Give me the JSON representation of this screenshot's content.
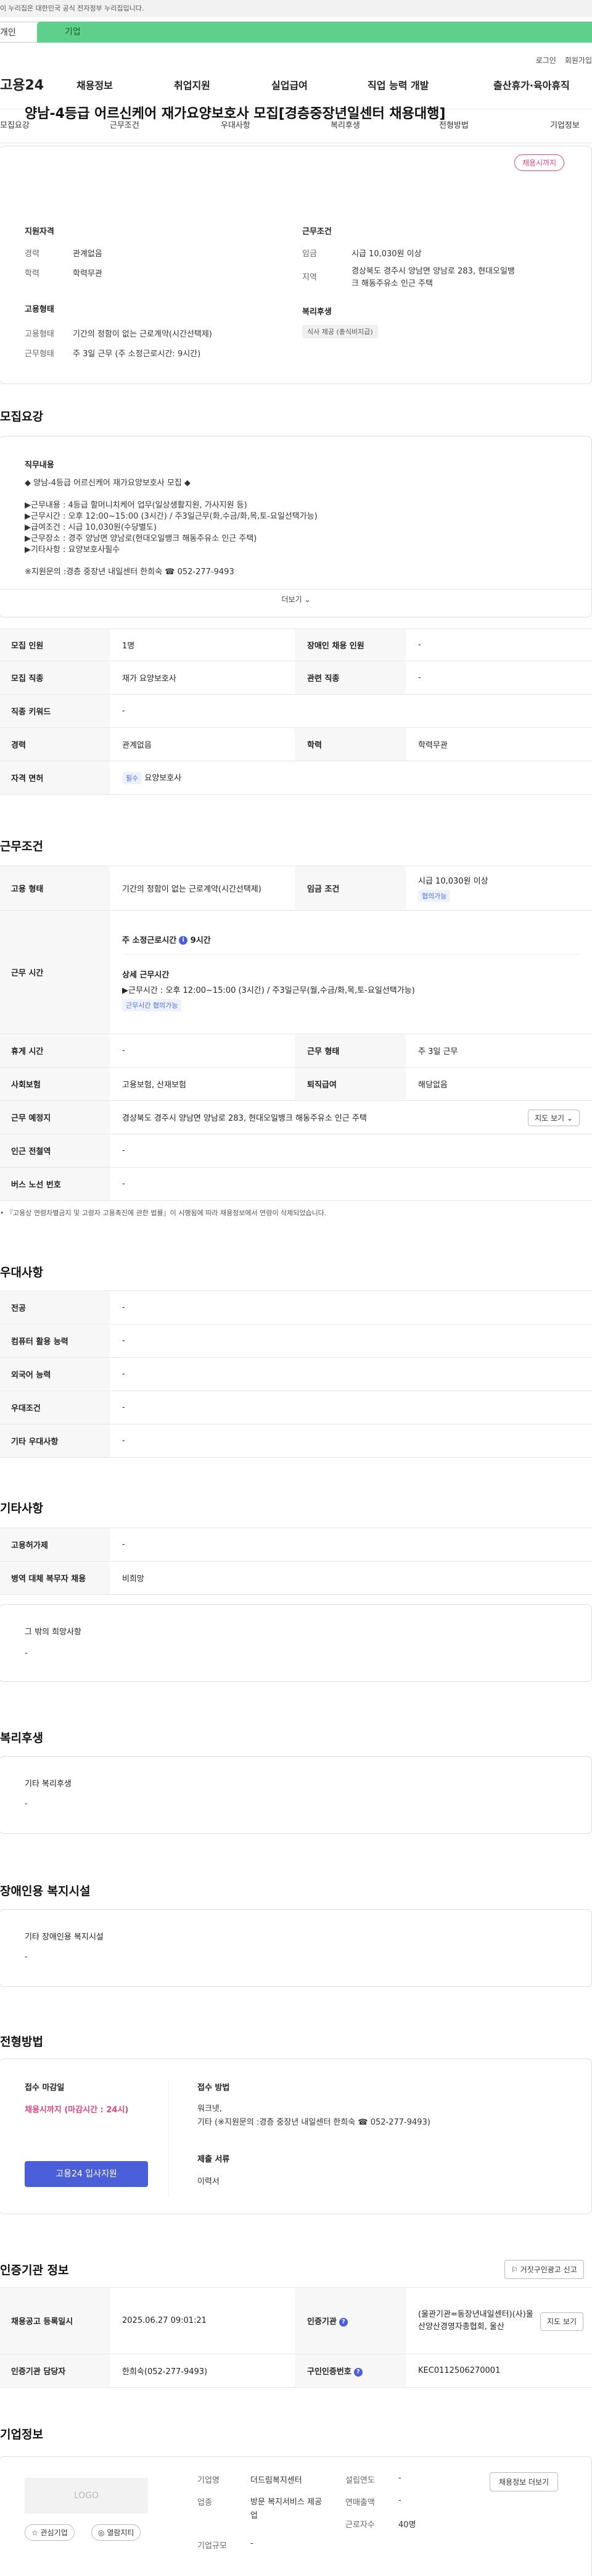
{
  "gov_banner": "이 누리집은 대한민국 공식 전자정부 누리집입니다.",
  "top_tabs": {
    "person": "개인",
    "corp": "기업"
  },
  "util": [
    "로그인",
    "회원가입"
  ],
  "brand": "고용24",
  "gnb": [
    "채용정보",
    "취업지원",
    "실업급여",
    "직업 능력 개발",
    "출산휴가·육아휴직"
  ],
  "subnav": [
    "모집요강",
    "근무조건",
    "우대사항",
    "복리후생",
    "전형방법",
    "기업정보"
  ],
  "header": {
    "title": "양남-4등급 어르신케어 재가요양보호사 모집[경층중장년일센터 채용대행]",
    "badge": "채용시까지",
    "qual_head": "지원자격",
    "qual": [
      {
        "k": "경력",
        "v": "관계없음"
      },
      {
        "k": "학력",
        "v": "학력무관"
      }
    ],
    "cond_head": "근무조건",
    "cond": [
      {
        "k": "임금",
        "v": "시급 10,030원 이상"
      },
      {
        "k": "지역",
        "v": "경상북도 경주시 양남면 양남로 283, 현대오일뱅크 해동주유소 인근 주택"
      }
    ],
    "emp_head": "고용형태",
    "emp": [
      {
        "k": "고용형태",
        "v": "기간의 정함이 없는 근로계약(시간선택제)"
      },
      {
        "k": "근무형태",
        "v": "주 3일 근무 (주 소정근로시간: 9시간)"
      }
    ],
    "welfare_head": "복리후생",
    "welfare_chip": "식사 제공 (총식비지급)"
  },
  "recruit": {
    "section": "모집요강",
    "duty_head": "직무내용",
    "duty_lines": [
      "◆ 양남-4등급 어르신케어 재가요양보호사 모집 ◆",
      "",
      "▶근무내용 : 4등급 할머니치케어 업무(일상생활지원, 가사지원 등)",
      "▶근무시간 : 오후 12:00~15:00 (3시간) / 주3일근무(화,수금/화,목,토-요일선택가능)",
      "▶급여조건 : 시급 10,030원(수당별도)",
      "▶근무장소 : 경주 양남면 양남로(현대오일뱅크 해동주유소 인근 주택)",
      "▶기타사항 : 요양보호사필수",
      "",
      "※지원문의 :경층 중장년 내일센터  한희숙 ☎ 052-277-9493"
    ],
    "more": "더보기",
    "rows": [
      {
        "k": "모집 인원",
        "v": "1명",
        "k2": "장애인 채용 인원",
        "v2": "-"
      },
      {
        "k": "모집 직종",
        "v": "재가 요양보호사",
        "k2": "관련 직종",
        "v2": "-"
      },
      {
        "k": "직종 키워드",
        "v": "-"
      },
      {
        "k": "경력",
        "v": "관계없음",
        "k2": "학력",
        "v2": "학력무관"
      },
      {
        "k": "자격 면허",
        "v": "요양보호사",
        "chip": "필수"
      }
    ]
  },
  "work": {
    "section": "근무조건",
    "emp_k": "고용 형태",
    "emp_v": "기간의 정함이 없는 근로계약(시간선택제)",
    "wage_k": "임금 조건",
    "wage_v": "시급 10,030원 이상",
    "wage_chip": "협의가능",
    "time_k": "근무 시간",
    "time_total": "주 소정근로시간",
    "time_total_v": "9시간",
    "time_detail_head": "상세 근무시간",
    "time_detail": "▶근무시간 :  오후 12:00~15:00 (3시간) / 주3일근무(월,수금/화,목,토-요일선택가능)",
    "time_chip": "근무시간 협의가능",
    "rows": [
      {
        "k": "휴게 시간",
        "v": "-",
        "k2": "근무 형태",
        "v2": "주 3일 근무"
      },
      {
        "k": "사회보험",
        "v": "고용보험, 산재보험",
        "k2": "퇴직급여",
        "v2": "해당없음"
      },
      {
        "k": "근무 예정지",
        "v": "경상북도 경주시 양남면 양남로 283, 현대오일뱅크 해동주유소 인근 주택",
        "btn": "지도 보기"
      },
      {
        "k": "인근 전철역",
        "v": "-"
      },
      {
        "k": "버스 노선 번호",
        "v": "-"
      }
    ],
    "note": "『고용상 연령차별금지 및 고령자 고용촉진에 관한 법률』이 시행됨에 따라 채용정보에서 연령이 삭제되었습니다."
  },
  "pref": {
    "section": "우대사항",
    "rows": [
      {
        "k": "전공",
        "v": "-"
      },
      {
        "k": "컴퓨터 활용 능력",
        "v": "-"
      },
      {
        "k": "외국어 능력",
        "v": "-"
      },
      {
        "k": "우대조건",
        "v": "-"
      },
      {
        "k": "기타 우대사항",
        "v": "-"
      }
    ]
  },
  "etc": {
    "section": "기타사항",
    "rows": [
      {
        "k": "고용허가제",
        "v": "-"
      },
      {
        "k": "병역 대체 복무자 채용",
        "v": "비희망"
      }
    ],
    "box_head": "그 밖의 희망사항",
    "box_v": "-"
  },
  "welfare": {
    "section": "복리후생",
    "box_head": "기타 복리후생",
    "box_v": "-"
  },
  "disabled": {
    "section": "장애인용 복지시설",
    "box_head": "기타 장애인용 복지시설",
    "box_v": "-"
  },
  "process": {
    "section": "전형방법",
    "deadline_head": "접수 마감일",
    "deadline_v": "채용시까지 (마감시간 : 24시)",
    "apply_btn": "고용24 입사지원",
    "method_head": "접수 방법",
    "method_lines": [
      "워크넷,",
      "기타 (※지원문의 :경층 중장년 내일센터  한희숙 ☎ 052-277-9493)"
    ],
    "docs_head": "제출 서류",
    "docs_v": "이력서"
  },
  "agency": {
    "section": "인증기관 정보",
    "report_btn": "거짓구인광고 신고",
    "reg_k": "채용공고 등록일시",
    "reg_v": "2025.06.27 09:01:21",
    "org_k": "인증기관",
    "org_v": "(울관기관=동장년내일센터)(사)울산양산경영자총협회, 울산",
    "org_btn": "지도 보기",
    "mgr_k": "인증기관 담당자",
    "mgr_v": "한희숙(052-277-9493)",
    "no_k": "구인인증번호",
    "no_v": "KEC0112506270001"
  },
  "company": {
    "section": "기업정보",
    "logo": "LOGO",
    "fav_btn": "관심기업",
    "follow_btn": "열람지티",
    "info_btn": "채용정보 더보기",
    "rows_left": [
      {
        "k": "기업명",
        "v": "더드림복지센터"
      },
      {
        "k": "업종",
        "v": "방문 복지서비스 제공업"
      },
      {
        "k": "기업규모",
        "v": "-"
      }
    ],
    "rows_right": [
      {
        "k": "설립연도",
        "v": "-"
      },
      {
        "k": "연매출액",
        "v": "-"
      },
      {
        "k": "근로자수",
        "v": "40명"
      }
    ]
  }
}
